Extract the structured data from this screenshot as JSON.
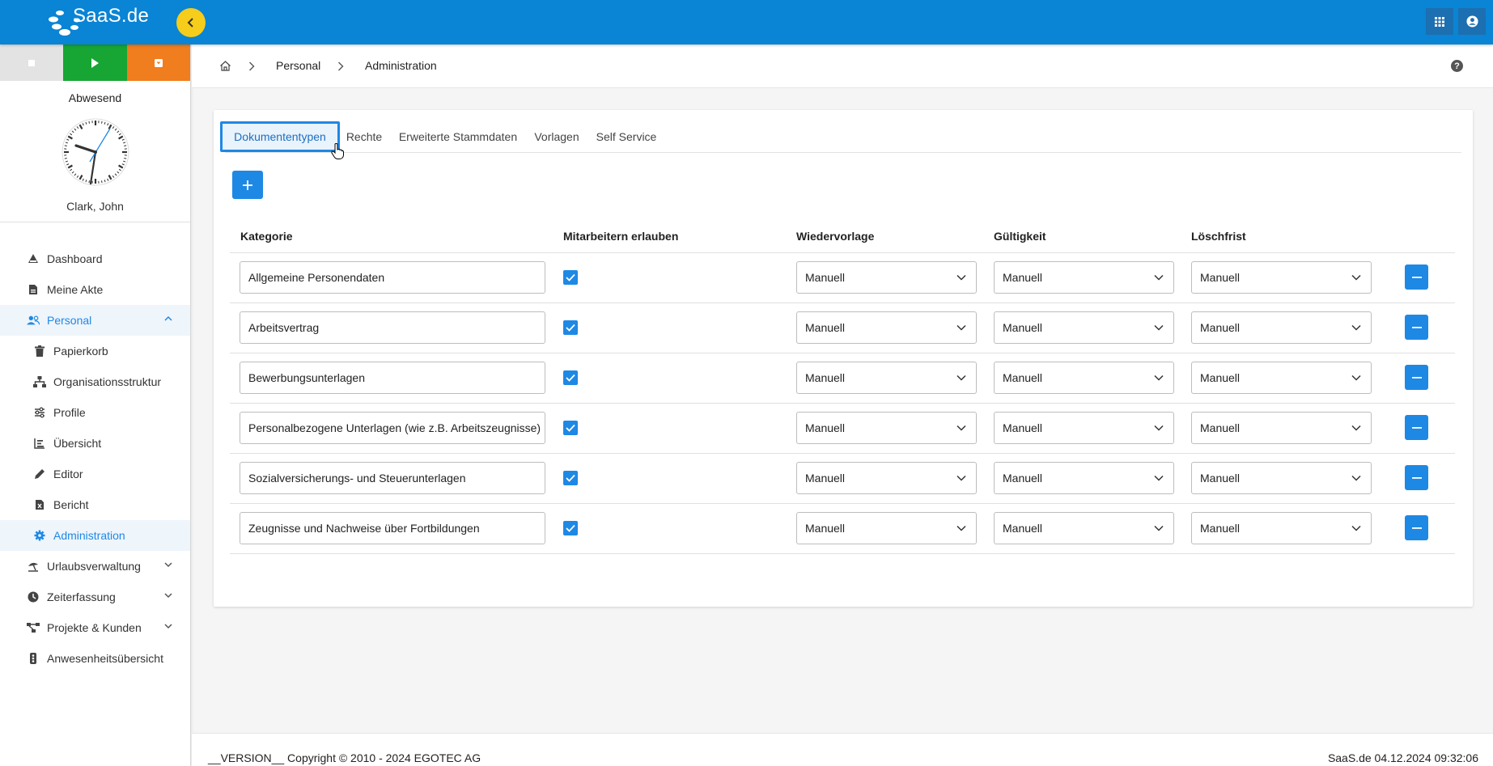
{
  "brand": {
    "logo_text": "SaaS.de"
  },
  "topbar": {
    "collapse_icon": "chevron-left-icon",
    "apps_icon": "apps-grid-icon",
    "account_icon": "account-circle-icon"
  },
  "sidebar": {
    "status_buttons": [
      "stop",
      "play",
      "dropdown"
    ],
    "status_label": "Abwesend",
    "user_name": "Clark, John",
    "nav": [
      {
        "label": "Dashboard",
        "icon": "dashboard-icon"
      },
      {
        "label": "Meine Akte",
        "icon": "file-icon"
      },
      {
        "label": "Personal",
        "icon": "people-icon",
        "expanded": true
      },
      {
        "label": "Papierkorb",
        "icon": "trash-icon"
      },
      {
        "label": "Organisationsstruktur",
        "icon": "org-chart-icon"
      },
      {
        "label": "Profile",
        "icon": "sliders-icon"
      },
      {
        "label": "Übersicht",
        "icon": "bar-chart-icon"
      },
      {
        "label": "Editor",
        "icon": "pencil-icon"
      },
      {
        "label": "Bericht",
        "icon": "report-icon"
      },
      {
        "label": "Administration",
        "icon": "gear-icon",
        "active": true
      },
      {
        "label": "Urlaubsverwaltung",
        "icon": "beach-umbrella-icon"
      },
      {
        "label": "Zeiterfassung",
        "icon": "clock-icon"
      },
      {
        "label": "Projekte & Kunden",
        "icon": "project-icon"
      },
      {
        "label": "Anwesenheitsübersicht",
        "icon": "traffic-light-icon"
      }
    ]
  },
  "breadcrumb": {
    "home_icon": "home-icon",
    "items": [
      "Personal",
      "Administration"
    ]
  },
  "tabs": [
    "Dokumententypen",
    "Rechte",
    "Erweiterte Stammdaten",
    "Vorlagen",
    "Self Service"
  ],
  "active_tab": "Dokumententypen",
  "table": {
    "headers": [
      "Kategorie",
      "Mitarbeitern erlauben",
      "Wiedervorlage",
      "Gültigkeit",
      "Löschfrist"
    ],
    "rows": [
      {
        "kategorie": "Allgemeine Personendaten",
        "erlauben": true,
        "wiedervorlage": "Manuell",
        "gueltigkeit": "Manuell",
        "loeschfrist": "Manuell"
      },
      {
        "kategorie": "Arbeitsvertrag",
        "erlauben": true,
        "wiedervorlage": "Manuell",
        "gueltigkeit": "Manuell",
        "loeschfrist": "Manuell"
      },
      {
        "kategorie": "Bewerbungsunterlagen",
        "erlauben": true,
        "wiedervorlage": "Manuell",
        "gueltigkeit": "Manuell",
        "loeschfrist": "Manuell"
      },
      {
        "kategorie": "Personalbezogene Unterlagen (wie z.B. Arbeitszeugnisse)",
        "erlauben": true,
        "wiedervorlage": "Manuell",
        "gueltigkeit": "Manuell",
        "loeschfrist": "Manuell"
      },
      {
        "kategorie": "Sozialversicherungs- und Steuerunterlagen",
        "erlauben": true,
        "wiedervorlage": "Manuell",
        "gueltigkeit": "Manuell",
        "loeschfrist": "Manuell"
      },
      {
        "kategorie": "Zeugnisse und Nachweise über Fortbildungen",
        "erlauben": true,
        "wiedervorlage": "Manuell",
        "gueltigkeit": "Manuell",
        "loeschfrist": "Manuell"
      }
    ]
  },
  "footer": {
    "left": "__VERSION__ Copyright © 2010 - 2024 EGOTEC AG",
    "right": "SaaS.de  04.12.2024 09:32:06"
  },
  "colors": {
    "topbar": "#0a84d4",
    "accent": "#1e88e5",
    "play": "#17a534",
    "dropdown": "#f07d1e",
    "collapse": "#f6cd1a"
  }
}
